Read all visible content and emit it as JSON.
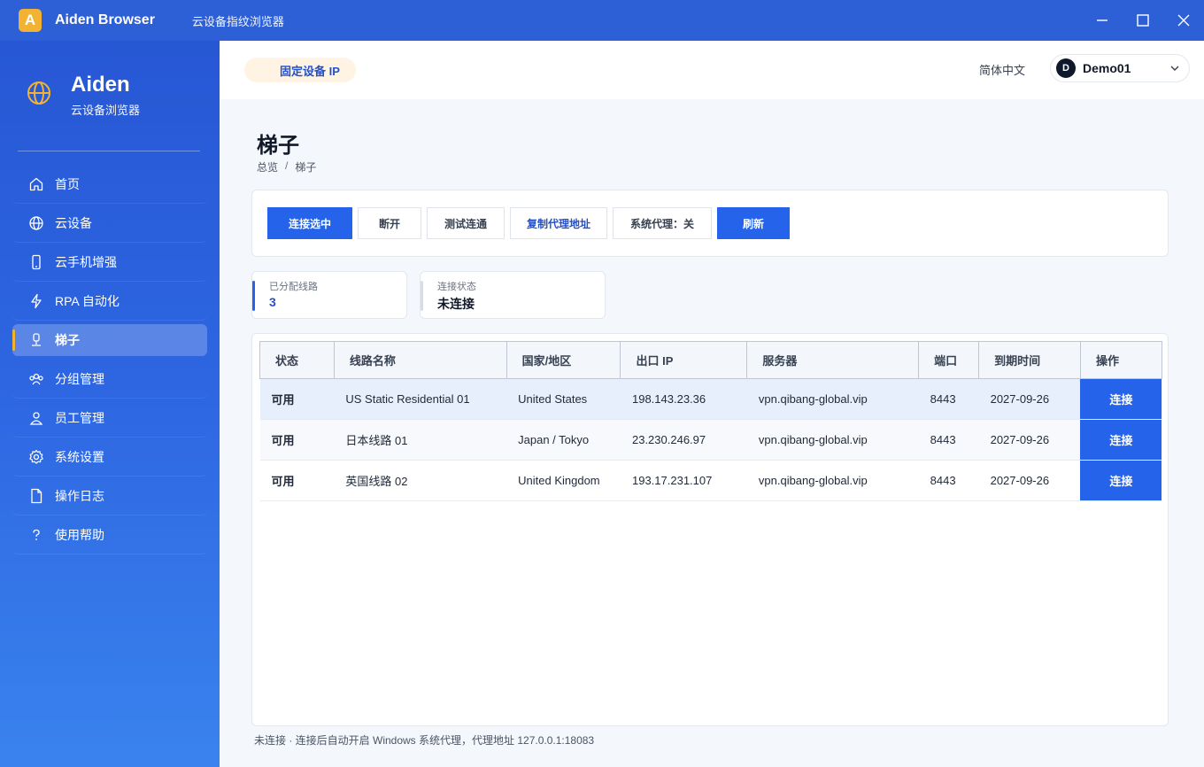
{
  "app": {
    "logo_letter": "A",
    "name": "Aiden Browser",
    "subtitle": "云设备指纹浏览器"
  },
  "sidebar": {
    "brand_title": "Aiden",
    "brand_subtitle": "云设备浏览器",
    "items": [
      {
        "label": "首页",
        "icon": "home-icon"
      },
      {
        "label": "云设备",
        "icon": "globe-icon"
      },
      {
        "label": "云手机增强",
        "icon": "phone-icon"
      },
      {
        "label": "RPA 自动化",
        "icon": "lightning-icon"
      },
      {
        "label": "梯子",
        "icon": "ladder-icon",
        "active": true
      },
      {
        "label": "分组管理",
        "icon": "group-icon"
      },
      {
        "label": "员工管理",
        "icon": "user-icon"
      },
      {
        "label": "系统设置",
        "icon": "gear-icon"
      },
      {
        "label": "操作日志",
        "icon": "document-icon"
      },
      {
        "label": "使用帮助",
        "icon": "help-icon"
      }
    ]
  },
  "header": {
    "pill_label": "固定设备 IP",
    "language": "简体中文",
    "user_initial": "D",
    "user_name": "Demo01"
  },
  "page": {
    "title": "梯子",
    "breadcrumb": [
      "总览",
      "/",
      "梯子"
    ]
  },
  "toolbar": {
    "connect_selected": "连接选中",
    "disconnect": "断开",
    "test_connectivity": "测试连通",
    "copy_proxy": "复制代理地址",
    "system_proxy": "系统代理：关",
    "refresh": "刷新"
  },
  "stats": {
    "assigned_label": "已分配线路",
    "assigned_value": "3",
    "status_label": "连接状态",
    "status_value": "未连接"
  },
  "table": {
    "headers": [
      "状态",
      "线路名称",
      "国家/地区",
      "出口 IP",
      "服务器",
      "端口",
      "到期时间",
      "操作"
    ],
    "rows": [
      {
        "status": "可用",
        "name": "US Static Residential 01",
        "country": "United States",
        "ip": "198.143.23.36",
        "server": "vpn.qibang-global.vip",
        "port": "8443",
        "expiry": "2027-09-26",
        "action": "连接"
      },
      {
        "status": "可用",
        "name": "日本线路 01",
        "country": "Japan / Tokyo",
        "ip": "23.230.246.97",
        "server": "vpn.qibang-global.vip",
        "port": "8443",
        "expiry": "2027-09-26",
        "action": "连接"
      },
      {
        "status": "可用",
        "name": "英国线路 02",
        "country": "United Kingdom",
        "ip": "193.17.231.107",
        "server": "vpn.qibang-global.vip",
        "port": "8443",
        "expiry": "2027-09-26",
        "action": "连接"
      }
    ]
  },
  "footer": {
    "note": "未连接 · 连接后自动开启 Windows 系统代理，代理地址 127.0.0.1:18083"
  },
  "colors": {
    "titlebar": "#2d5fd6",
    "primary": "#2563eb",
    "accent": "#f2b233"
  }
}
